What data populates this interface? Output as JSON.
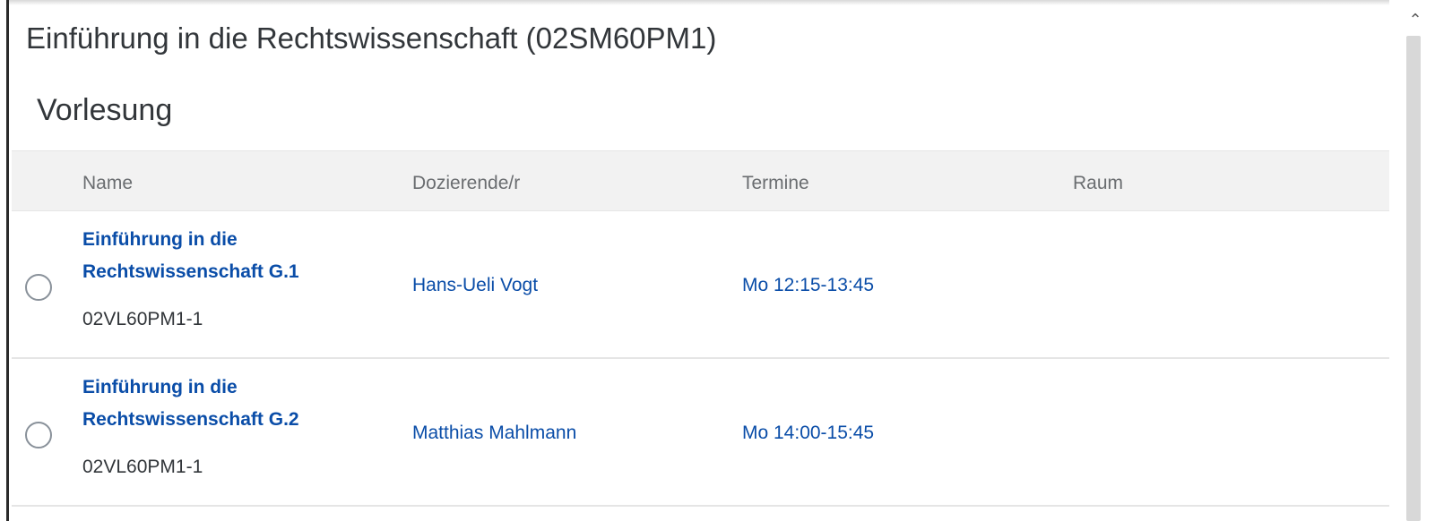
{
  "module": {
    "title": "Einführung in die Rechtswissenschaft (02SM60PM1)"
  },
  "section": {
    "title": "Vorlesung"
  },
  "table": {
    "columns": [
      "Name",
      "Dozierende/r",
      "Termine",
      "Raum"
    ],
    "rows": [
      {
        "name_line1": "Einführung in die",
        "name_line2": "Rechtswissenschaft G.1",
        "code": "02VL60PM1-1",
        "lecturer": "Hans-Ueli Vogt",
        "schedule": "Mo 12:15-13:45",
        "room": ""
      },
      {
        "name_line1": "Einführung in die",
        "name_line2": "Rechtswissenschaft G.2",
        "code": "02VL60PM1-1",
        "lecturer": "Matthias Mahlmann",
        "schedule": "Mo 14:00-15:45",
        "room": ""
      }
    ]
  },
  "icons": {
    "scroll_up": "chevron-up-icon",
    "row_select": "radio-button-icon"
  },
  "colors": {
    "link": "#0a4da8",
    "text": "#32363a",
    "header_text": "#6a6d70",
    "header_bg": "#f2f2f2"
  }
}
